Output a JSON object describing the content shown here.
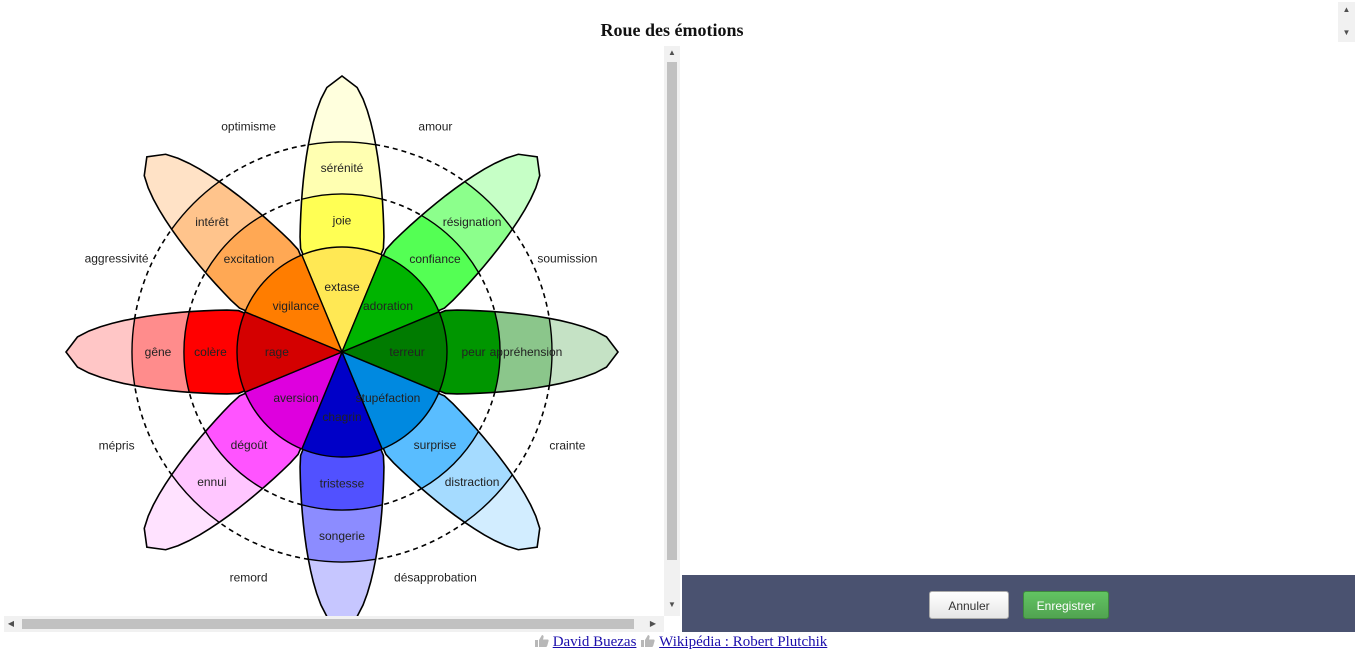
{
  "page": {
    "title": "Roue des émotions"
  },
  "wheel": {
    "petals": [
      {
        "inner": "extase",
        "middle": "joie",
        "outer": "sérénité",
        "colors": [
          "#ffe854",
          "#ffff54",
          "#ffffb1",
          "#ffffdd"
        ]
      },
      {
        "inner": "adoration",
        "middle": "confiance",
        "outer": "résignation",
        "colors": [
          "#00b400",
          "#54ff54",
          "#8cff8c",
          "#c6ffc6"
        ]
      },
      {
        "inner": "terreur",
        "middle": "peur",
        "outer": "appréhension",
        "colors": [
          "#007b00",
          "#009600",
          "#8bc68b",
          "#c5e2c5"
        ]
      },
      {
        "inner": "stupéfaction",
        "middle": "surprise",
        "outer": "distraction",
        "colors": [
          "#0089e0",
          "#59bdff",
          "#a5dbff",
          "#d2edff"
        ]
      },
      {
        "inner": "chagrin",
        "middle": "tristesse",
        "outer": "songerie",
        "colors": [
          "#0000c8",
          "#5151ff",
          "#8c8cff",
          "#c6c6ff"
        ]
      },
      {
        "inner": "aversion",
        "middle": "dégoût",
        "outer": "ennui",
        "colors": [
          "#de00de",
          "#ff54ff",
          "#ffc6ff",
          "#ffe2ff"
        ]
      },
      {
        "inner": "rage",
        "middle": "colère",
        "outer": "gêne",
        "colors": [
          "#d40000",
          "#ff0000",
          "#ff8c8c",
          "#ffc6c6"
        ]
      },
      {
        "inner": "vigilance",
        "middle": "excitation",
        "outer": "intérêt",
        "colors": [
          "#ff7d00",
          "#ffa854",
          "#ffc48c",
          "#ffe2c6"
        ]
      }
    ],
    "dyads": [
      "amour",
      "soumission",
      "crainte",
      "désapprobation",
      "remord",
      "mépris",
      "aggressivité",
      "optimisme"
    ]
  },
  "actions": {
    "cancel_label": "Annuler",
    "save_label": "Enregistrer"
  },
  "credits": {
    "author_link": "David Buezas",
    "source_link": "Wikipédia : Robert Plutchik"
  }
}
